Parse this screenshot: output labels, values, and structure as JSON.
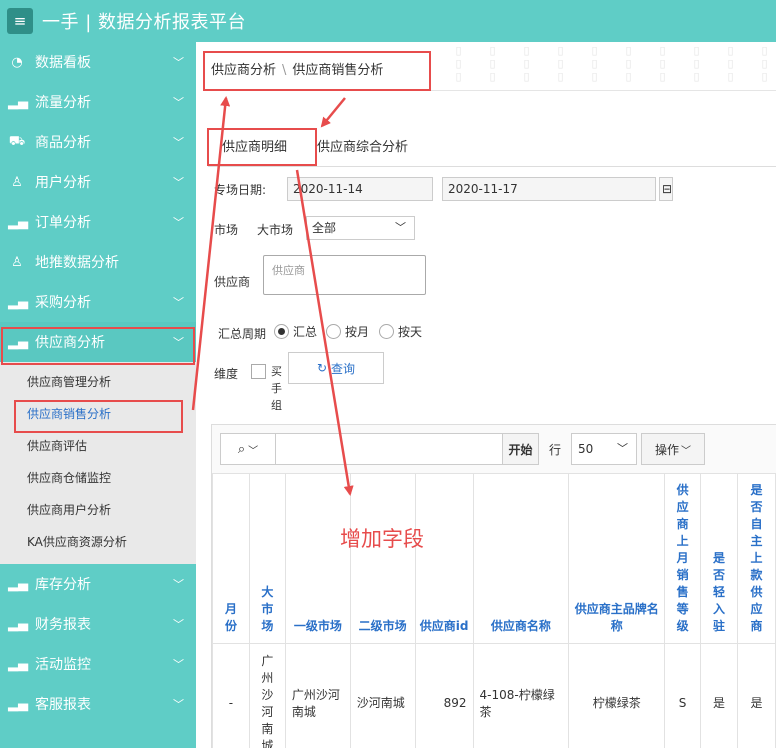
{
  "app": {
    "title": "一手 | 数据分析报表平台"
  },
  "sidebar": {
    "items": [
      {
        "label": "数据看板",
        "icon": "dashboard-icon"
      },
      {
        "label": "流量分析",
        "icon": "bar-chart-icon"
      },
      {
        "label": "商品分析",
        "icon": "cart-icon"
      },
      {
        "label": "用户分析",
        "icon": "user-icon"
      },
      {
        "label": "订单分析",
        "icon": "bar-chart-icon"
      },
      {
        "label": "地推数据分析",
        "icon": "user-add-icon"
      },
      {
        "label": "采购分析",
        "icon": "bar-chart-icon"
      },
      {
        "label": "供应商分析",
        "icon": "bar-chart-icon"
      }
    ],
    "submenu": [
      "供应商管理分析",
      "供应商销售分析",
      "供应商评估",
      "供应商仓储监控",
      "供应商用户分析",
      "KA供应商资源分析"
    ],
    "items_after": [
      {
        "label": "库存分析",
        "icon": "bar-chart-icon"
      },
      {
        "label": "财务报表",
        "icon": "bar-chart-icon"
      },
      {
        "label": "活动监控",
        "icon": "bar-chart-icon"
      },
      {
        "label": "客服报表",
        "icon": "bar-chart-icon"
      }
    ]
  },
  "breadcrumb": {
    "parent": "供应商分析",
    "current": "供应商销售分析",
    "separator": "\\"
  },
  "tabs": {
    "detail": "供应商明细",
    "summary": "供应商综合分析"
  },
  "filters": {
    "date_label": "专场日期:",
    "date_start": "2020-11-14",
    "date_end": "2020-11-17",
    "market_label": "市场",
    "big_market_label": "大市场",
    "big_market_value": "全部",
    "supplier_label": "供应商",
    "supplier_placeholder": "供应商",
    "period_label": "汇总周期",
    "period_options": [
      "汇总",
      "按月",
      "按天"
    ],
    "dimension_label": "维度",
    "dimension_option_frag": "买手组",
    "query_label": "查询"
  },
  "grid": {
    "start_label": "开始",
    "rows_label": "行",
    "rows_value": "50",
    "actions_label": "操作",
    "columns": [
      "月份",
      "大市场",
      "一级市场",
      "二级市场",
      "供应商id",
      "供应商名称",
      "供应商主品牌名称",
      "供应商上月销售等级",
      "是否轻入驻",
      "是否自主上款供应商"
    ],
    "rows": [
      [
        "-",
        "广州沙河南城",
        "广州沙河南城",
        "沙河南城",
        "892",
        "4-108-柠檬绿茶",
        "柠檬绿茶",
        "S",
        "是",
        "是"
      ]
    ]
  },
  "annotation": {
    "text": "增加字段"
  },
  "colors": {
    "accent": "#5fcdc6",
    "annotation": "#e74c4c",
    "link": "#2a70c8"
  }
}
